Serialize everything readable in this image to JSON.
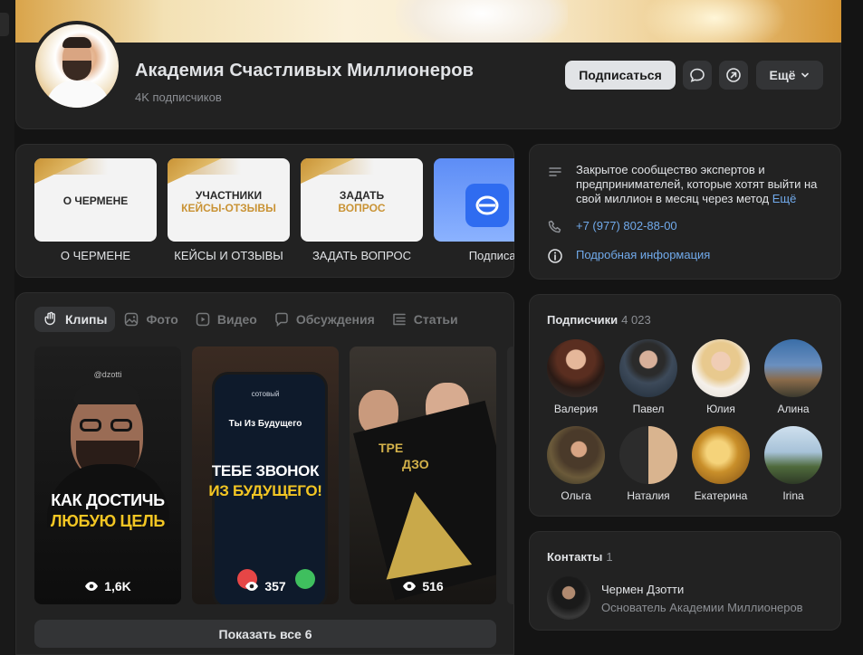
{
  "group": {
    "name": "Академия Счастливых Миллионеров",
    "subscribers": "4K подписчиков",
    "subscribe_label": "Подписаться",
    "more_label": "Ещё"
  },
  "quick_links": [
    {
      "line1": "О ЧЕРМЕНЕ",
      "line2": "",
      "label": "О ЧЕРМЕНЕ"
    },
    {
      "line1": "УЧАСТНИКИ",
      "line2": "КЕЙСЫ-ОТЗЫВЫ",
      "label": "КЕЙСЫ И ОТЗЫВЫ"
    },
    {
      "line1": "ЗАДАТЬ",
      "line2": "ВОПРОС",
      "label": "ЗАДАТЬ ВОПРОС"
    },
    {
      "line1": "",
      "line2": "",
      "label": "Подписат"
    }
  ],
  "tabs": [
    {
      "label": "Клипы",
      "icon": "clips-icon",
      "active": true
    },
    {
      "label": "Фото",
      "icon": "photo-icon",
      "active": false
    },
    {
      "label": "Видео",
      "icon": "video-icon",
      "active": false
    },
    {
      "label": "Обсуждения",
      "icon": "discussions-icon",
      "active": false
    },
    {
      "label": "Статьи",
      "icon": "articles-icon",
      "active": false
    }
  ],
  "clips": [
    {
      "handle": "@dzotti",
      "line1": "КАК ДОСТИЧЬ",
      "line2": "ЛЮБУЮ ЦЕЛЬ",
      "views": "1,6K"
    },
    {
      "operator": "сотовый",
      "caller": "Ты Из Будущего",
      "line1": "ТЕБЕ ЗВОНОК",
      "line2": "ИЗ БУДУЩЕГО!",
      "views": "357"
    },
    {
      "line1": "ТРЕ",
      "line2": "ДЗО",
      "views": "516"
    }
  ],
  "show_all_label": "Показать все 6",
  "about": {
    "description": "Закрытое сообщество экспертов и предпринимателей, которые хотят выйти на свой миллион в месяц через метод",
    "more": "Ещё",
    "phone": "+7 (977) 802-88-00",
    "details": "Подробная информация"
  },
  "followers": {
    "title": "Подписчики",
    "count": "4 023",
    "people": [
      {
        "name": "Валерия"
      },
      {
        "name": "Павел"
      },
      {
        "name": "Юлия"
      },
      {
        "name": "Алина"
      },
      {
        "name": "Ольга"
      },
      {
        "name": "Наталия"
      },
      {
        "name": "Екатерина"
      },
      {
        "name": "Irina"
      }
    ]
  },
  "contacts": {
    "title": "Контакты",
    "count": "1",
    "name": "Чермен Дзотти",
    "role": "Основатель Академии Миллионеров"
  }
}
